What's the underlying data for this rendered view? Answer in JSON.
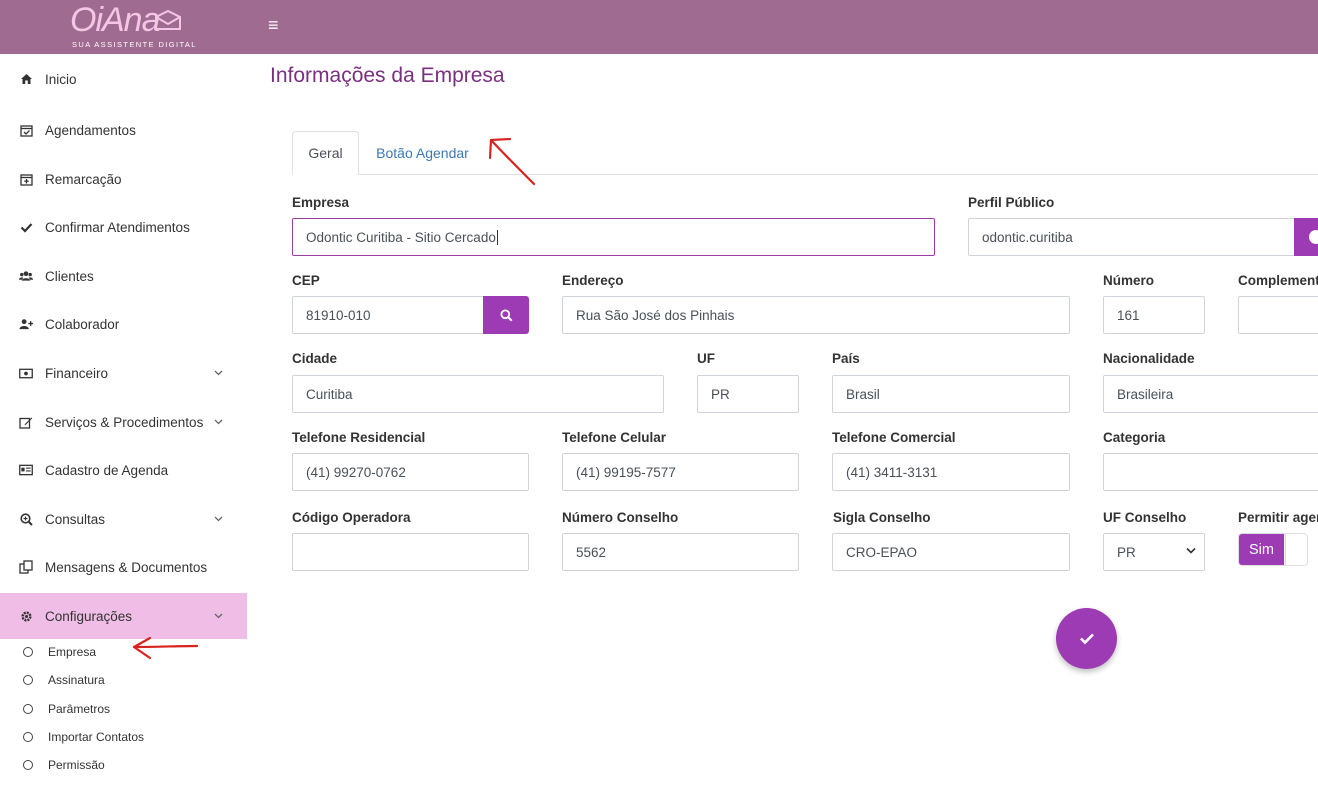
{
  "header": {
    "logo_text": "OiAna",
    "logo_tagline": "SUA  ASSISTENTE  DIGITAL",
    "menu_icon": "hamburger-icon",
    "colors": {
      "topbar": "#a06b91",
      "accent": "#9c3bb4",
      "active_nav": "#f0bde6",
      "title": "#7a2f80"
    }
  },
  "sidebar": {
    "items": [
      {
        "label": "Inicio",
        "icon": "home-icon"
      },
      {
        "label": "Agendamentos",
        "icon": "calendar-check-icon"
      },
      {
        "label": "Remarcação",
        "icon": "calendar-plus-icon"
      },
      {
        "label": "Confirmar Atendimentos",
        "icon": "check-icon"
      },
      {
        "label": "Clientes",
        "icon": "users-icon"
      },
      {
        "label": "Colaborador",
        "icon": "user-plus-icon"
      },
      {
        "label": "Financeiro",
        "icon": "money-icon",
        "expandable": true
      },
      {
        "label": "Serviços & Procedimentos",
        "icon": "edit-icon",
        "expandable": true
      },
      {
        "label": "Cadastro de Agenda",
        "icon": "id-card-icon"
      },
      {
        "label": "Consultas",
        "icon": "search-plus-icon",
        "expandable": true
      },
      {
        "label": "Mensagens & Documentos",
        "icon": "copy-icon"
      },
      {
        "label": "Configurações",
        "icon": "gear-icon",
        "expandable": true,
        "active": true
      }
    ],
    "subitems": [
      {
        "label": "Empresa"
      },
      {
        "label": "Assinatura"
      },
      {
        "label": "Parâmetros"
      },
      {
        "label": "Importar Contatos"
      },
      {
        "label": "Permissão"
      }
    ]
  },
  "main": {
    "title": "Informações da Empresa",
    "tabs": [
      {
        "label": "Geral",
        "active": true
      },
      {
        "label": "Botão Agendar",
        "active": false
      }
    ],
    "fields": {
      "empresa": {
        "label": "Empresa",
        "value": "Odontic Curitiba - Sitio Cercado"
      },
      "perfil_publico": {
        "label": "Perfil Público",
        "value": "odontic.curitiba"
      },
      "cep": {
        "label": "CEP",
        "value": "81910-010"
      },
      "endereco": {
        "label": "Endereço",
        "value": "Rua São José dos Pinhais"
      },
      "numero": {
        "label": "Número",
        "value": "161"
      },
      "complemento": {
        "label": "Complement",
        "value": ""
      },
      "cidade": {
        "label": "Cidade",
        "value": "Curitiba"
      },
      "uf": {
        "label": "UF",
        "value": "PR"
      },
      "pais": {
        "label": "País",
        "value": "Brasil"
      },
      "nacionalidade": {
        "label": "Nacionalidade",
        "value": "Brasileira"
      },
      "telefone_residencial": {
        "label": "Telefone Residencial",
        "value": "(41) 99270-0762"
      },
      "telefone_celular": {
        "label": "Telefone Celular",
        "value": "(41) 99195-7577"
      },
      "telefone_comercial": {
        "label": "Telefone Comercial",
        "value": "(41) 3411-3131"
      },
      "categoria": {
        "label": "Categoria",
        "value": ""
      },
      "codigo_operadora": {
        "label": "Código Operadora",
        "value": ""
      },
      "numero_conselho": {
        "label": "Número Conselho",
        "value": "5562"
      },
      "sigla_conselho": {
        "label": "Sigla Conselho",
        "value": "CRO-EPAO"
      },
      "uf_conselho": {
        "label": "UF Conselho",
        "value": "PR"
      },
      "permitir_agendamento": {
        "label": "Permitir ager",
        "toggle_label": "Sim"
      }
    },
    "save_icon": "check-icon"
  }
}
